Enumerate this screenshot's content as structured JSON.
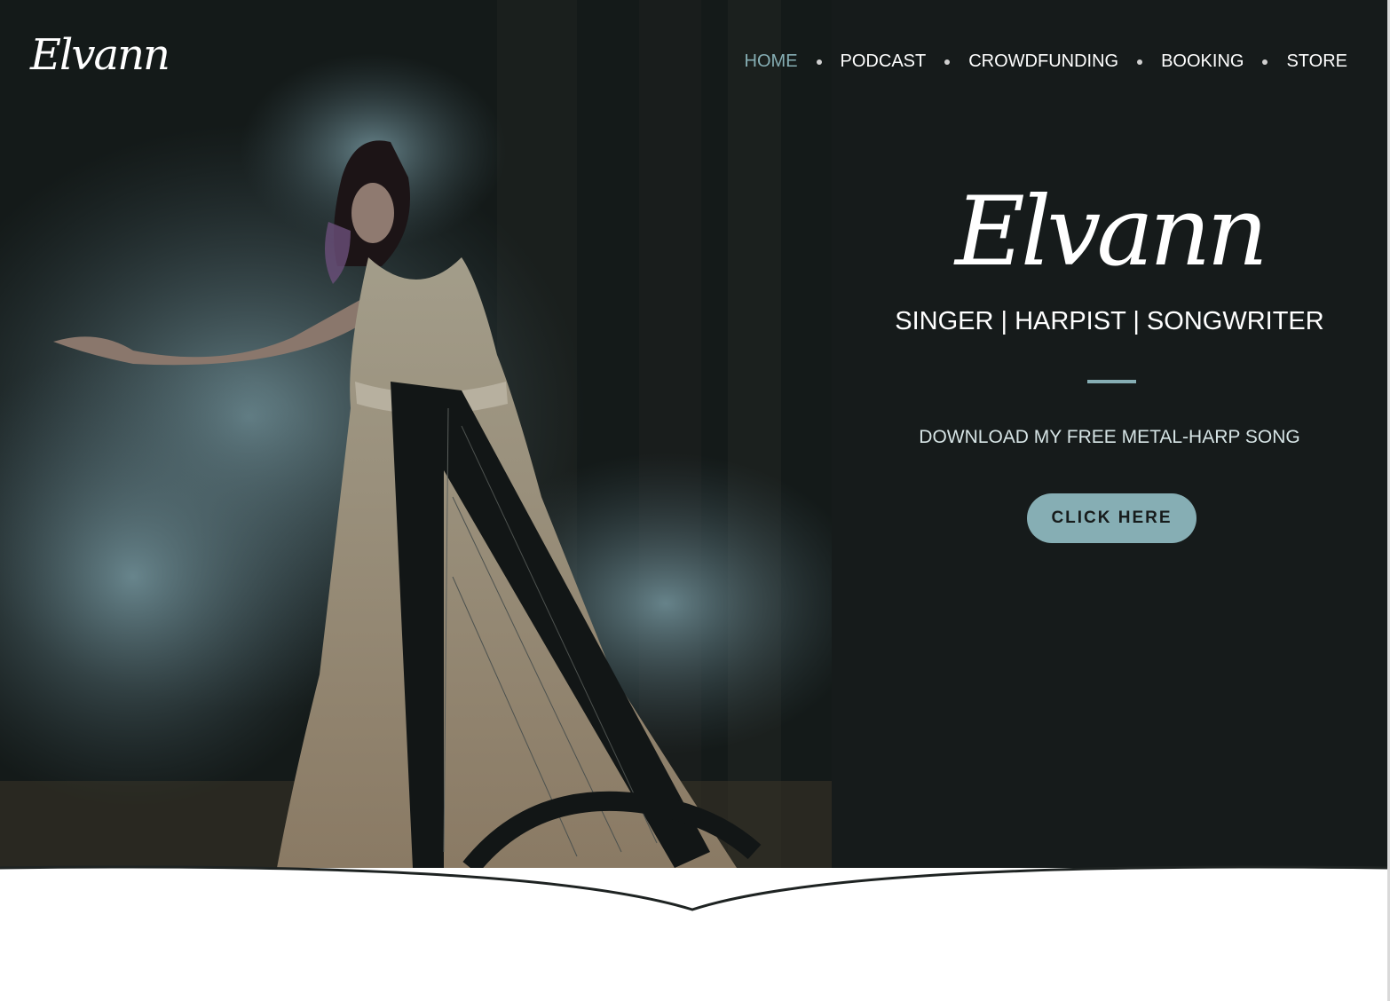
{
  "site": {
    "logo_text": "Elvann"
  },
  "nav": {
    "items": [
      {
        "label": "HOME",
        "active": true
      },
      {
        "label": "PODCAST"
      },
      {
        "label": "CROWDFUNDING"
      },
      {
        "label": "BOOKING"
      },
      {
        "label": "STORE"
      }
    ]
  },
  "hero": {
    "title": "Elvann",
    "tagline": "SINGER | HARPIST | SONGWRITER",
    "download_text": "DOWNLOAD MY FREE METAL-HARP SONG",
    "cta_label": "CLICK HERE"
  },
  "colors": {
    "accent": "#86aeb4",
    "hero_bg": "#161b1b",
    "text": "#ffffff"
  },
  "icons": {
    "nav_separator": "bullet-dot"
  }
}
